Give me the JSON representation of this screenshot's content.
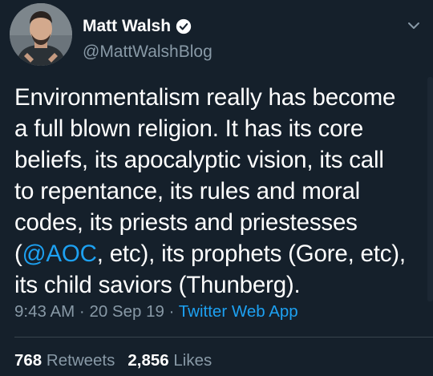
{
  "user": {
    "display_name": "Matt Walsh",
    "handle": "@MattWalshBlog",
    "verified": true
  },
  "tweet": {
    "lines": [
      [
        "Environmentalism really has become"
      ],
      [
        "a full blown religion. It has its core"
      ],
      [
        "beliefs, its apocalyptic vision, its call"
      ],
      [
        "to repentance, its rules and moral"
      ],
      [
        "codes, its priests and priestesses"
      ],
      [
        "(",
        "@AOC",
        ", etc), its prophets (Gore, etc),"
      ],
      [
        "its child saviors (Thunberg)."
      ]
    ]
  },
  "meta": {
    "time": "9:43 AM",
    "separator": " · ",
    "date": "20 Sep 19",
    "source": "Twitter Web App"
  },
  "stats": {
    "retweets_count": "768",
    "retweets_label": "Retweets",
    "likes_count": "2,856",
    "likes_label": "Likes"
  },
  "colors": {
    "background": "#15202b",
    "text": "#ffffff",
    "secondary": "#8899a6",
    "accent": "#1da1f2",
    "divider": "#38444d"
  },
  "icons": {
    "verified": "verified-badge-icon",
    "caret": "chevron-down-icon"
  }
}
